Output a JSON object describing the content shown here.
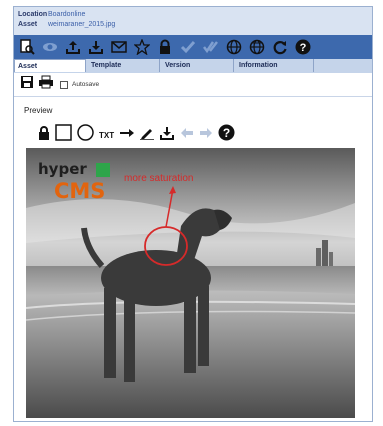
{
  "header": {
    "location_key": "Location",
    "location_value": "Boardonline",
    "asset_key": "Asset",
    "asset_value": "weimaraner_2015.jpg"
  },
  "toolbar": {
    "icons": [
      "preview-icon",
      "eye-icon",
      "upload-icon",
      "download-icon",
      "mail-icon",
      "star-icon",
      "lock-icon",
      "check-icon",
      "double-check-icon",
      "globe-icon",
      "globe-alt-icon",
      "refresh-icon",
      "help-icon"
    ]
  },
  "tabs": [
    {
      "label": "Asset"
    },
    {
      "label": "Template"
    },
    {
      "label": "Version"
    },
    {
      "label": "Information"
    }
  ],
  "savebar": {
    "autosave_label": "Autosave"
  },
  "preview": {
    "title": "Preview",
    "text_tool_label": "TXT"
  },
  "image": {
    "logo_hyper": "hyper",
    "logo_cms": "CMS",
    "annotation_text": "more saturation"
  },
  "colors": {
    "toolbar_blue": "#3d69ad",
    "header_bg": "#d9e3f2",
    "annotation_red": "#d62a2a",
    "logo_orange": "#e2640e",
    "logo_green": "#2ea54a"
  }
}
